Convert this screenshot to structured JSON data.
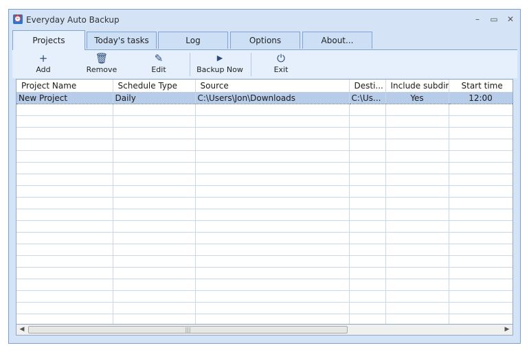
{
  "window": {
    "title": "Everyday Auto Backup"
  },
  "tabs": [
    "Projects",
    "Today's tasks",
    "Log",
    "Options",
    "About..."
  ],
  "toolbar": {
    "add": "Add",
    "remove": "Remove",
    "edit": "Edit",
    "backup_now": "Backup Now",
    "exit": "Exit"
  },
  "table": {
    "columns": [
      "Project Name",
      "Schedule Type",
      "Source",
      "Desti...",
      "Include subdir",
      "Start time"
    ],
    "rows": [
      [
        "New Project",
        "Daily",
        "C:\\Users\\Jon\\Downloads",
        "C:\\Us...",
        "Yes",
        "12:00"
      ]
    ]
  },
  "icons": {
    "app": "alarm-clock-icon",
    "add": "plus-icon",
    "remove": "trash-icon",
    "edit": "pencil-icon",
    "backup_now": "play-icon",
    "exit": "power-icon"
  },
  "colors": {
    "window_bg": "#d4e3f6",
    "selection": "#b6cce8",
    "accent": "#2b74d8"
  }
}
